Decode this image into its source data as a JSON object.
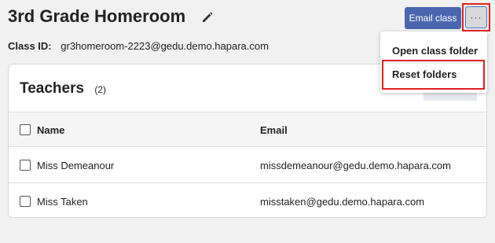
{
  "header": {
    "title": "3rd Grade Homeroom",
    "class_id_label": "Class ID:",
    "class_id_value": "gr3homeroom-2223@gedu.demo.hapara.com",
    "email_button": "Email class",
    "more_button": "···"
  },
  "menu": {
    "items": [
      {
        "label": "Open class folder"
      },
      {
        "label": "Reset folders"
      }
    ]
  },
  "teachers": {
    "heading": "Teachers",
    "count": "(2)",
    "columns": {
      "name": "Name",
      "email": "Email"
    },
    "rows": [
      {
        "name": "Miss Demeanour",
        "email": "missdemeanour@gedu.demo.hapara.com"
      },
      {
        "name": "Miss Taken",
        "email": "misstaken@gedu.demo.hapara.com"
      }
    ]
  },
  "colors": {
    "accent": "#4a66ad",
    "highlight": "#e21f1f"
  }
}
